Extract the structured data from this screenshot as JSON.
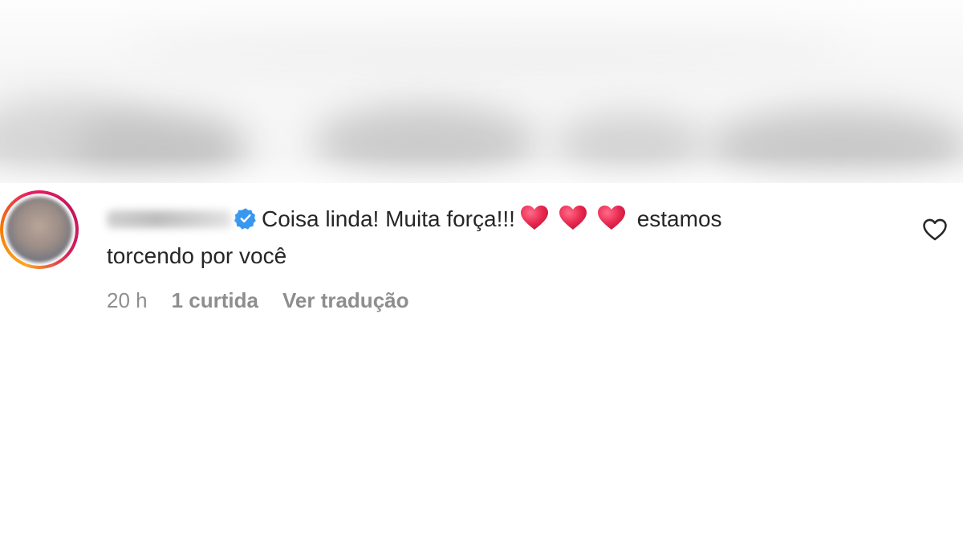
{
  "comment": {
    "username_hidden": true,
    "verified": true,
    "text_part1": "Coisa linda! Muita força!!!",
    "text_part2": "estamos",
    "text_part3": "torcendo por você",
    "emoji": [
      "red-heart",
      "red-heart",
      "red-heart"
    ],
    "time": "20 h",
    "likes": "1 curtida",
    "translate": "Ver tradução"
  },
  "colors": {
    "text": "#262626",
    "meta": "#8e8e8e",
    "verified": "#3897f0",
    "heart": "#e8284f"
  },
  "icons": {
    "verified": "verified-badge-icon",
    "like": "heart-outline-icon"
  }
}
